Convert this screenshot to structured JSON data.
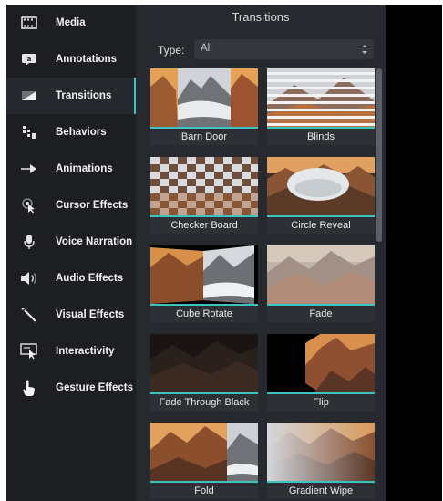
{
  "sidebar": {
    "items": [
      {
        "label": "Media",
        "icon": "film-strip-icon",
        "active": false
      },
      {
        "label": "Annotations",
        "icon": "annotation-callout-icon",
        "active": false
      },
      {
        "label": "Transitions",
        "icon": "transition-gradient-icon",
        "active": true
      },
      {
        "label": "Behaviors",
        "icon": "behaviors-dots-icon",
        "active": false
      },
      {
        "label": "Animations",
        "icon": "animation-arrow-icon",
        "active": false
      },
      {
        "label": "Cursor Effects",
        "icon": "cursor-effect-icon",
        "active": false
      },
      {
        "label": "Voice Narration",
        "icon": "microphone-icon",
        "active": false
      },
      {
        "label": "Audio Effects",
        "icon": "speaker-icon",
        "active": false
      },
      {
        "label": "Visual Effects",
        "icon": "magic-wand-icon",
        "active": false
      },
      {
        "label": "Interactivity",
        "icon": "interactive-screen-icon",
        "active": false
      },
      {
        "label": "Gesture Effects",
        "icon": "hand-gesture-icon",
        "active": false
      }
    ]
  },
  "panel": {
    "title": "Transitions",
    "type_label": "Type:",
    "type_value": "All"
  },
  "transitions": [
    {
      "name": "Barn Door"
    },
    {
      "name": "Blinds"
    },
    {
      "name": "Checker Board"
    },
    {
      "name": "Circle Reveal"
    },
    {
      "name": "Cube Rotate"
    },
    {
      "name": "Fade"
    },
    {
      "name": "Fade Through Black"
    },
    {
      "name": "Flip"
    },
    {
      "name": "Fold"
    },
    {
      "name": "Gradient Wipe"
    }
  ],
  "colors": {
    "accent": "#3cc3c0",
    "sidebar_bg": "#1c1e22",
    "panel_bg": "#26292e"
  }
}
